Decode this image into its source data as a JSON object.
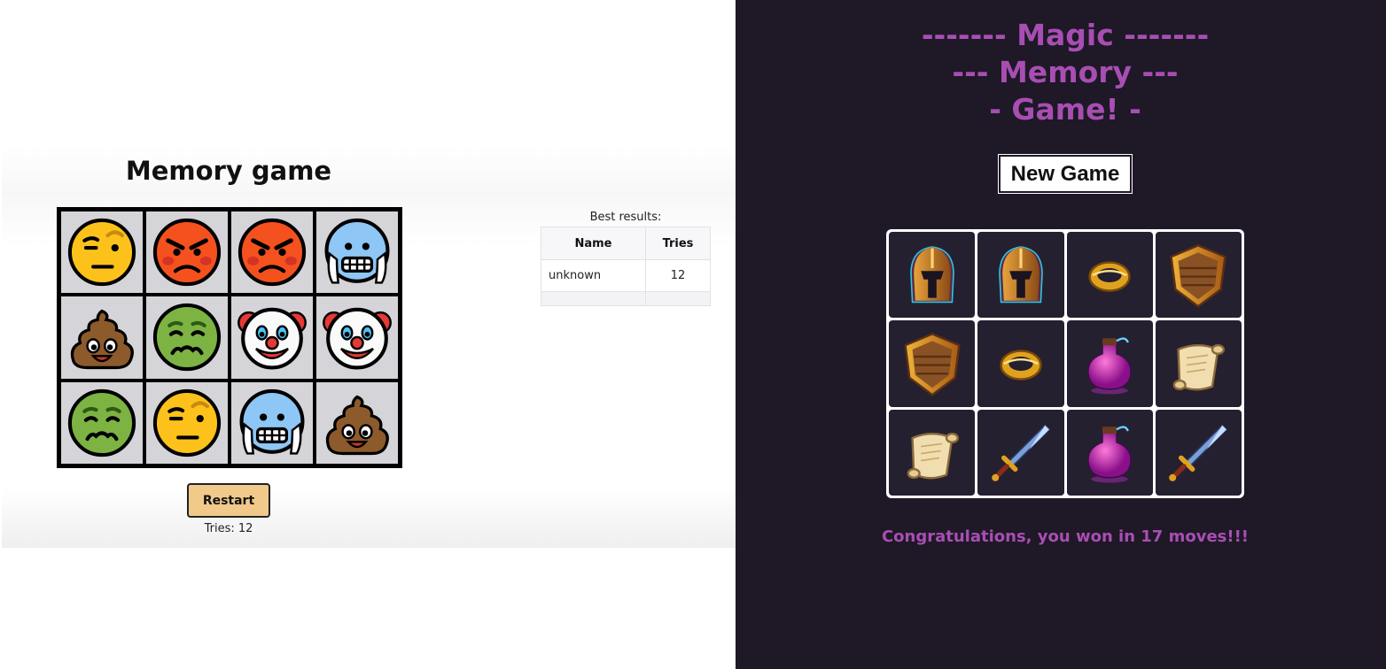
{
  "left_game": {
    "title": "Memory game",
    "cards": [
      {
        "emoji": "raised-eyebrow-face"
      },
      {
        "emoji": "angry-face"
      },
      {
        "emoji": "angry-face"
      },
      {
        "emoji": "cold-face"
      },
      {
        "emoji": "poop"
      },
      {
        "emoji": "nauseated-face"
      },
      {
        "emoji": "clown-face"
      },
      {
        "emoji": "clown-face"
      },
      {
        "emoji": "nauseated-face"
      },
      {
        "emoji": "raised-eyebrow-face"
      },
      {
        "emoji": "cold-face"
      },
      {
        "emoji": "poop"
      }
    ],
    "restart_label": "Restart",
    "tries_text": "Tries: 12",
    "best_results": {
      "caption": "Best results:",
      "headers": [
        "Name",
        "Tries"
      ],
      "rows": [
        {
          "name": "unknown",
          "tries": "12"
        }
      ]
    },
    "colors": {
      "card_bg": "#d5d4d9",
      "board_border": "#000000",
      "restart_bg": "#f1c98b"
    }
  },
  "right_game": {
    "title_lines": [
      "------- Magic -------",
      "--- Memory ---",
      "- Game! -"
    ],
    "new_game_label": "New Game",
    "cards": [
      {
        "item": "helmet"
      },
      {
        "item": "helmet"
      },
      {
        "item": "ring"
      },
      {
        "item": "shield"
      },
      {
        "item": "shield"
      },
      {
        "item": "ring"
      },
      {
        "item": "potion"
      },
      {
        "item": "scroll"
      },
      {
        "item": "scroll"
      },
      {
        "item": "sword"
      },
      {
        "item": "potion"
      },
      {
        "item": "sword"
      }
    ],
    "congrats_text": "Congratulations, you won in 17 moves!!!",
    "colors": {
      "background": "#1e1827",
      "accent": "#a84eb3",
      "card_bg": "#252030"
    }
  }
}
